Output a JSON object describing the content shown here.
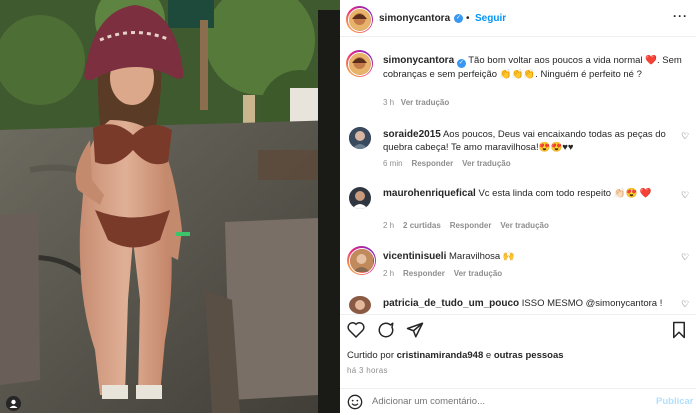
{
  "post": {
    "username": "simonycantora",
    "follow_label": "Seguir",
    "caption": {
      "username": "simonycantora",
      "text": "Tão bom voltar aos poucos a vida normal ❤️. Sem cobranças e sem perfeição 👏👏👏. Ninguém é perfeito né ?",
      "age": "3 h",
      "translate_label": "Ver tradução"
    }
  },
  "comments": [
    {
      "username": "soraide2015",
      "text": "Aos poucos, Deus vai encaixando todas as peças do quebra cabeça! Te amo maravilhosa!😍😍♥♥",
      "age": "6 min",
      "reply_label": "Responder",
      "translate_label": "Ver tradução",
      "avatar_color": "#3a4a5e"
    },
    {
      "username": "maurohenriquefical",
      "text": "Vc esta linda com todo respeito 👏🏻😍 ❤️",
      "age": "2 h",
      "replies_label": "2 curtidas",
      "reply_label": "Responder",
      "translate_label": "Ver tradução",
      "avatar_color": "#2f3640"
    },
    {
      "username": "vicentinisueli",
      "text": "Maravilhosa 🙌",
      "age": "2 h",
      "reply_label": "Responder",
      "translate_label": "Ver tradução",
      "avatar_color": "#c08a5c"
    },
    {
      "username": "patricia_de_tudo_um_pouco",
      "text": "ISSO MESMO @simonycantora !",
      "avatar_color": "#8a5a44"
    }
  ],
  "liked_by": {
    "prefix": "Curtido por",
    "user": "cristinamiranda948",
    "suffix": "e",
    "others": "outras pessoas"
  },
  "posted_ago": "há 3 horas",
  "comment_input": {
    "placeholder": "Adicionar um comentário...",
    "publish_label": "Publicar"
  },
  "icons": {
    "like": "heart-icon",
    "comment": "comment-icon",
    "share": "paper-plane-icon",
    "save": "bookmark-icon",
    "emoji": "smiley-icon",
    "more": "ellipsis-icon"
  }
}
